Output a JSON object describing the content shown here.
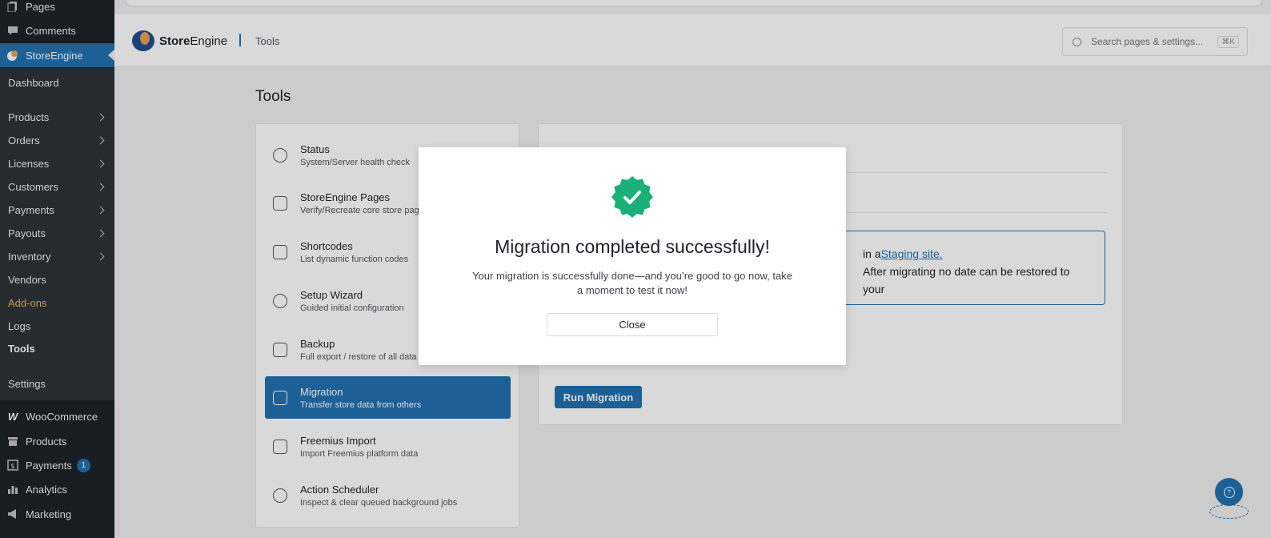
{
  "sidebar": {
    "top_items": [
      {
        "label": "Pages",
        "icon": "pages-icon"
      },
      {
        "label": "Comments",
        "icon": "comments-icon"
      },
      {
        "label": "StoreEngine",
        "icon": "storeengine-icon"
      }
    ],
    "submenu": [
      {
        "label": "Dashboard",
        "has_children": false
      },
      {
        "label": "Products",
        "has_children": true
      },
      {
        "label": "Orders",
        "has_children": true
      },
      {
        "label": "Licenses",
        "has_children": true
      },
      {
        "label": "Customers",
        "has_children": true
      },
      {
        "label": "Payments",
        "has_children": true
      },
      {
        "label": "Payouts",
        "has_children": true
      },
      {
        "label": "Inventory",
        "has_children": true
      },
      {
        "label": "Vendors",
        "has_children": false
      },
      {
        "label": "Add-ons",
        "has_children": false,
        "color": "#f0b849"
      },
      {
        "label": "Logs",
        "has_children": false
      },
      {
        "label": "Tools",
        "has_children": false,
        "current": true
      },
      {
        "label": "Settings",
        "has_children": false
      }
    ],
    "bottom_items": [
      {
        "label": "WooCommerce",
        "icon": "woocommerce-icon"
      },
      {
        "label": "Products",
        "icon": "products-box-icon"
      },
      {
        "label": "Payments",
        "icon": "payments-icon",
        "badge": "1"
      },
      {
        "label": "Analytics",
        "icon": "analytics-icon"
      },
      {
        "label": "Marketing",
        "icon": "megaphone-icon"
      }
    ]
  },
  "header": {
    "brand_bold": "Store",
    "brand_rest": "Engine",
    "section": "Tools",
    "search_placeholder": "Search pages & settings...",
    "search_shortcut": "⌘K"
  },
  "page": {
    "title": "Tools"
  },
  "tools": [
    {
      "title": "Status",
      "desc": "System/Server health check",
      "icon": "status-icon"
    },
    {
      "title": "StoreEngine Pages",
      "desc": "Verify/Recreate core store pages",
      "icon": "pages-list-icon"
    },
    {
      "title": "Shortcodes",
      "desc": "List dynamic function codes",
      "icon": "terminal-icon"
    },
    {
      "title": "Setup Wizard",
      "desc": "Guided initial configuration",
      "icon": "wizard-icon"
    },
    {
      "title": "Backup",
      "desc": "Full export / restore of all data",
      "icon": "file-backup-icon"
    },
    {
      "title": "Migration",
      "desc": "Transfer store data from others",
      "icon": "migration-icon",
      "active": true
    },
    {
      "title": "Freemius Import",
      "desc": "Import Freemius platform data",
      "icon": "freemius-icon"
    },
    {
      "title": "Action Scheduler",
      "desc": "Inspect & clear queued background jobs",
      "icon": "scheduler-icon"
    }
  ],
  "content": {
    "notice_line1_prefix": "in a",
    "notice_link": "Staging site.",
    "notice_line2": "After migrating no date can be restored to your",
    "run_button": "Run Migration"
  },
  "modal": {
    "title": "Migration completed successfully!",
    "message": "Your migration is successfully done—and you’re good to go now, take a moment to test it now!",
    "close_button": "Close",
    "accent": "#1bb07a"
  },
  "colors": {
    "primary": "#2271b1",
    "sidebar_bg": "#1d2327",
    "success": "#1bb07a"
  }
}
